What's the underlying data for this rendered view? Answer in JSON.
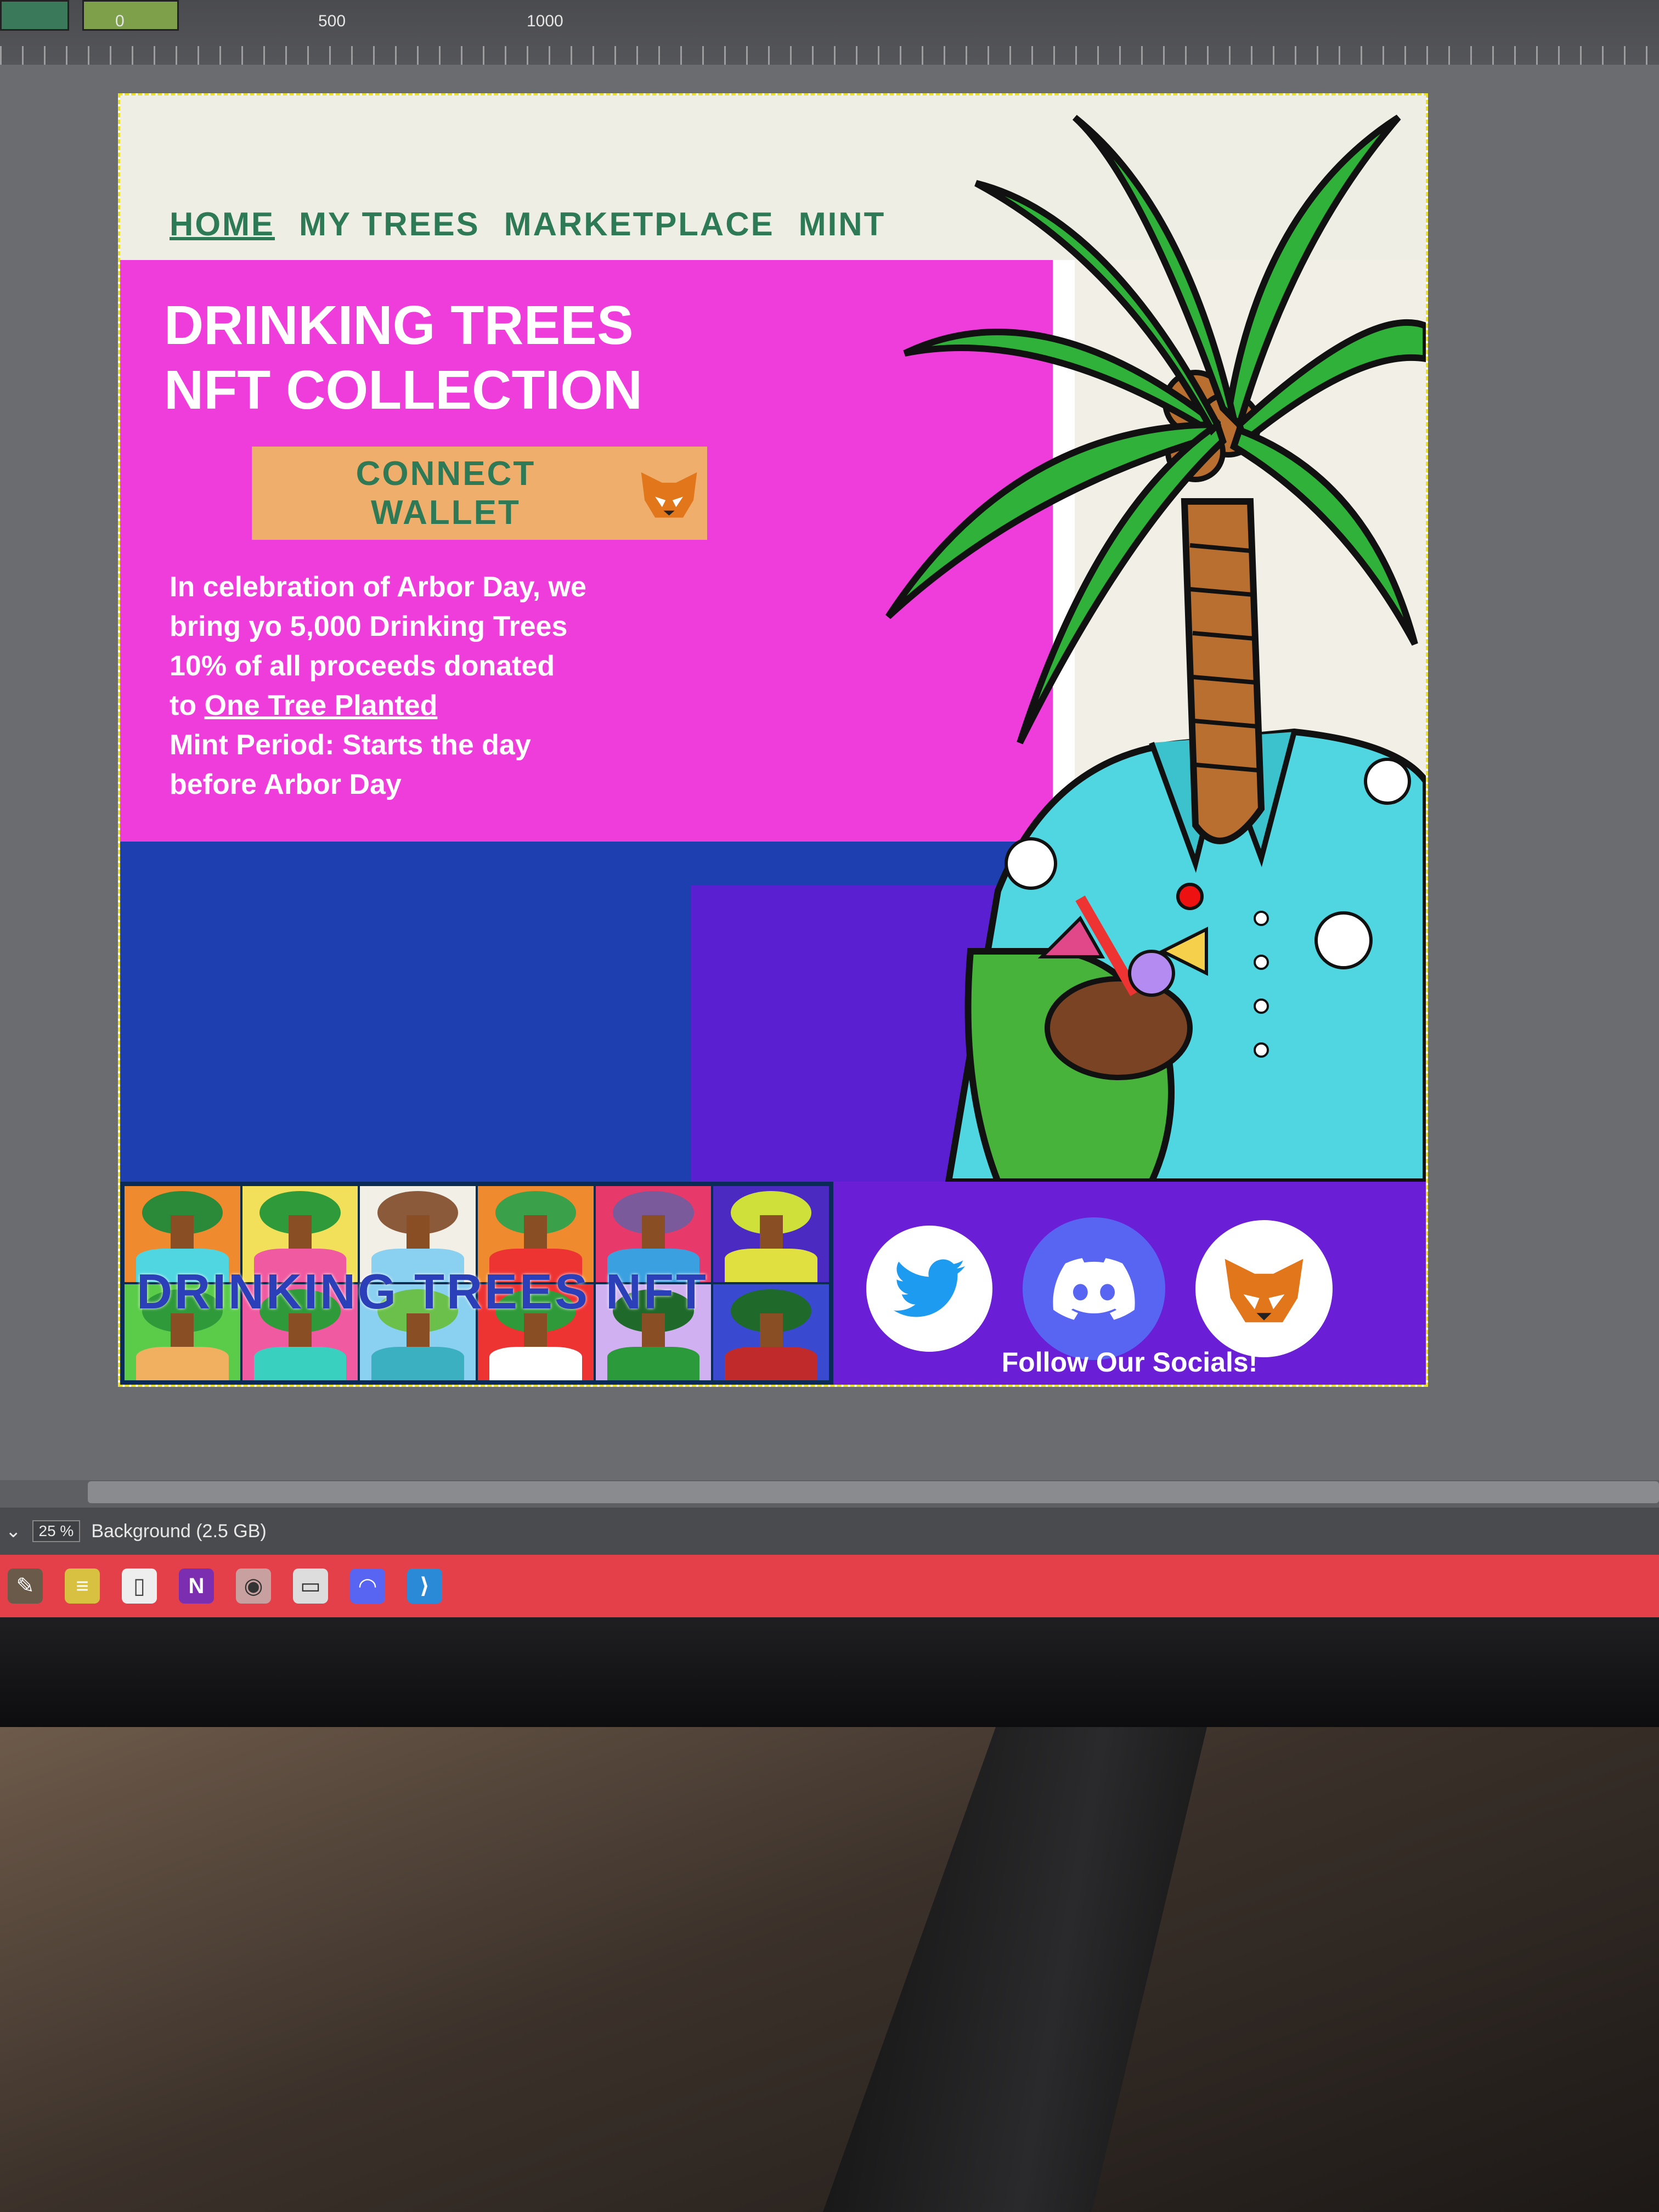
{
  "ruler": {
    "marks": [
      "0",
      "500",
      "1000"
    ]
  },
  "nav": {
    "items": [
      "HOME",
      "MY TREES",
      "MARKETPLACE",
      "MINT"
    ]
  },
  "hero": {
    "title": "DRINKING TREES\nNFT COLLECTION",
    "connect_label": "CONNECT WALLET",
    "desc_line1": "In celebration of Arbor Day, we",
    "desc_line2": "bring yo 5,000 Drinking Trees",
    "desc_line3": "10% of all proceeds donated",
    "desc_to": "to",
    "desc_link": "One Tree Planted",
    "desc_line5": "Mint Period: Starts the day",
    "desc_line6": "before Arbor Day"
  },
  "gallery": {
    "overlay": "DRINKING TREES NFT"
  },
  "socials": {
    "label": "Follow Our Socials!",
    "icons": [
      "twitter-icon",
      "discord-icon",
      "metamask-fox-icon"
    ]
  },
  "statusbar": {
    "zoom": "25 %",
    "layer": "Background (2.5 GB)"
  },
  "taskbar": {
    "icons": [
      "gimp-icon",
      "notepad-icon",
      "file-icon",
      "onenote-icon",
      "screenshot-icon",
      "remote-desktop-icon",
      "discord-icon",
      "vscode-icon"
    ]
  },
  "colors": {
    "nav_text": "#2f7a56",
    "hero_bg": "#ee3ddb",
    "blue_bg": "#1d3fb0",
    "social_bg": "#6a1fd6",
    "button_bg": "#efae6c"
  }
}
